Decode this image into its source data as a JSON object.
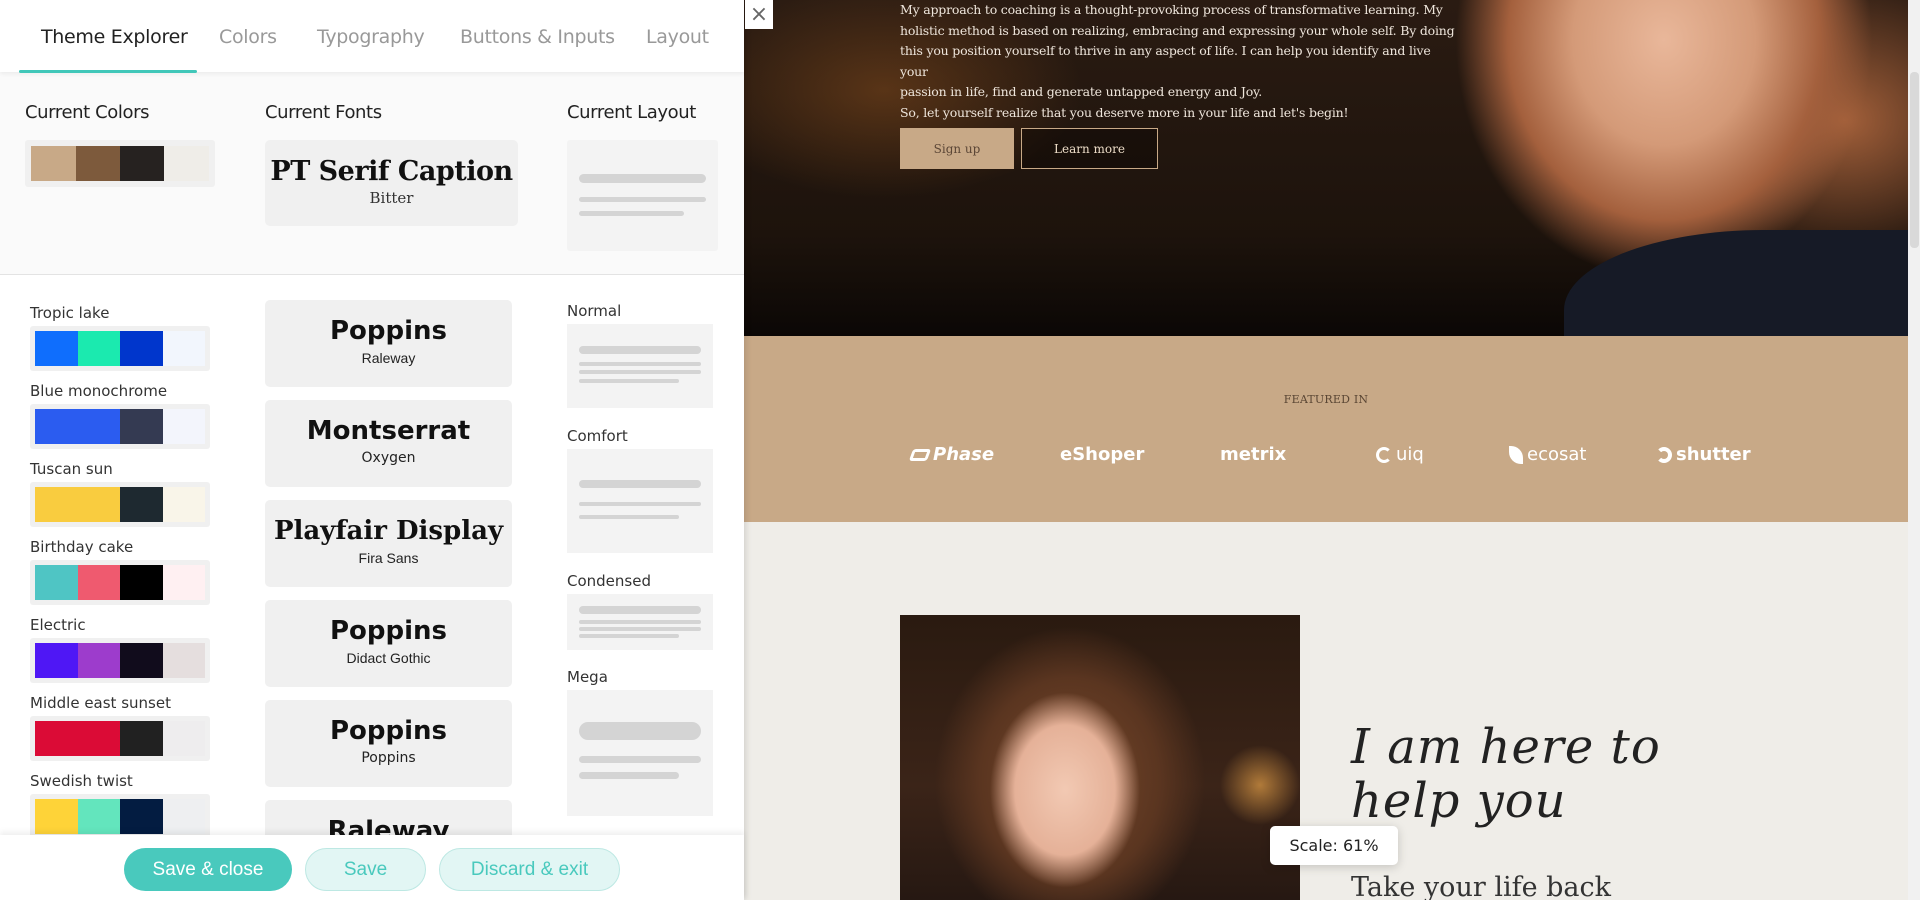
{
  "tabs": [
    {
      "label": "Theme Explorer",
      "active": true
    },
    {
      "label": "Colors",
      "active": false
    },
    {
      "label": "Typography",
      "active": false
    },
    {
      "label": "Buttons & Inputs",
      "active": false
    },
    {
      "label": "Layout",
      "active": false
    }
  ],
  "current": {
    "colors_title": "Current Colors",
    "fonts_title": "Current Fonts",
    "layout_title": "Current Layout",
    "colors": [
      "#c8a987",
      "#7d5a3c",
      "#262220",
      "#efede8"
    ],
    "font_heading": "PT Serif Caption",
    "font_body": "Bitter"
  },
  "palettes": [
    {
      "name": "Tropic lake",
      "colors": [
        "#0f6efd",
        "#1beaaf",
        "#0036cc",
        "#f2f6fd"
      ]
    },
    {
      "name": "Blue monochrome",
      "colors": [
        "#2b5cf0",
        "#2b5cf0",
        "#343a52",
        "#f3f5fc"
      ]
    },
    {
      "name": "Tuscan sun",
      "colors": [
        "#f9cc3f",
        "#f9cc3f",
        "#1e2930",
        "#f9f5e9"
      ]
    },
    {
      "name": "Birthday cake",
      "colors": [
        "#4fc5c4",
        "#ef5a6f",
        "#000000",
        "#fff0f2"
      ]
    },
    {
      "name": "Electric",
      "colors": [
        "#4f17f5",
        "#9d3ccc",
        "#110c1c",
        "#e5dede"
      ]
    },
    {
      "name": "Middle east sunset",
      "colors": [
        "#db0b36",
        "#db0b36",
        "#212121",
        "#eeedee"
      ]
    },
    {
      "name": "Swedish twist",
      "colors": [
        "#fed338",
        "#63e5bd",
        "#031c41",
        "#eeeff1"
      ]
    }
  ],
  "font_pairs": [
    {
      "heading": "Poppins",
      "body": "Raleway"
    },
    {
      "heading": "Montserrat",
      "body": "Oxygen"
    },
    {
      "heading": "Playfair Display",
      "body": "Fira Sans"
    },
    {
      "heading": "Poppins",
      "body": "Didact Gothic"
    },
    {
      "heading": "Poppins",
      "body": "Poppins"
    },
    {
      "heading": "Raleway",
      "body": ""
    }
  ],
  "layouts": [
    {
      "name": "Normal"
    },
    {
      "name": "Comfort"
    },
    {
      "name": "Condensed"
    },
    {
      "name": "Mega"
    }
  ],
  "footer": {
    "save_close": "Save & close",
    "save": "Save",
    "discard": "Discard & exit"
  },
  "close_icon": "×",
  "preview": {
    "hero_paragraph_lines": [
      "My approach to coaching is a thought-provoking process of transformative learning. My",
      "holistic method is based on realizing, embracing and expressing your whole self. By doing",
      "this you position yourself to thrive in any aspect of life. I can help you identify and live your",
      "passion in life, find and generate untapped energy and Joy.",
      "So, let yourself realize that you deserve more in your life and let's begin!"
    ],
    "signup_label": "Sign up",
    "learn_more_label": "Learn more",
    "featured_title": "FEATURED IN",
    "logos": [
      "Phase",
      "eShoper",
      "metrix",
      "uiq",
      "ecosat",
      "shutter"
    ],
    "headline": "I am here to help you",
    "subhead": "Take your life back"
  },
  "scale_label": "Scale: 61%",
  "colors": {
    "accent": "#49c9bd",
    "brand_tan": "#c8a987",
    "cream": "#efede8"
  }
}
